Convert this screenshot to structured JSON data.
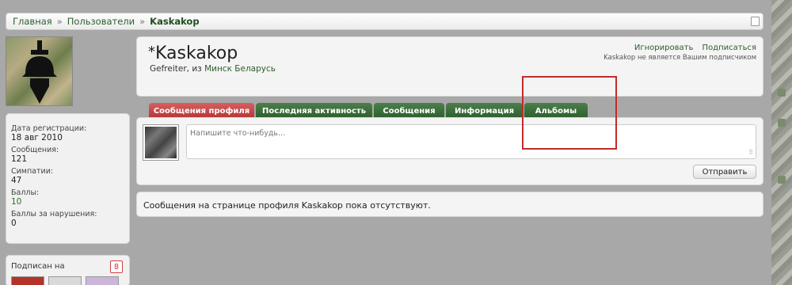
{
  "breadcrumb": {
    "home": "Главная",
    "separator": "»",
    "users": "Пользователи",
    "current": "Kaskakop"
  },
  "profile": {
    "star": "*",
    "name": "Kaskakop",
    "rank": "Gefreiter",
    "from_word": ", из ",
    "location": "Минск Беларусь",
    "ignore": "Игнорировать",
    "subscribe": "Подписаться",
    "not_subscriber_note": "Kaskakop не является Вашим подписчиком"
  },
  "stats": {
    "registered_label": "Дата регистрации:",
    "registered_value": "18 авг 2010",
    "messages_label": "Сообщения:",
    "messages_value": "121",
    "likes_label": "Симпатии:",
    "likes_value": "47",
    "points_label": "Баллы:",
    "points_value": "10",
    "warnings_label": "Баллы за нарушения:",
    "warnings_value": "0"
  },
  "following": {
    "title": "Подписан на",
    "count": "8"
  },
  "tabs": [
    {
      "label": "Сообщения профиля",
      "active": true
    },
    {
      "label": "Последняя активность",
      "active": false
    },
    {
      "label": "Сообщения",
      "active": false
    },
    {
      "label": "Информация",
      "active": false
    },
    {
      "label": "Альбомы",
      "active": false
    }
  ],
  "post": {
    "placeholder": "Напишите что-нибудь...",
    "send": "Отправить"
  },
  "empty_message": "Сообщения на странице профиля Kaskakop пока отсутствуют.",
  "colors": {
    "accent_green": "#2d5d2d",
    "active_tab_red": "#b33434",
    "annotation_red": "#c42a2a"
  }
}
